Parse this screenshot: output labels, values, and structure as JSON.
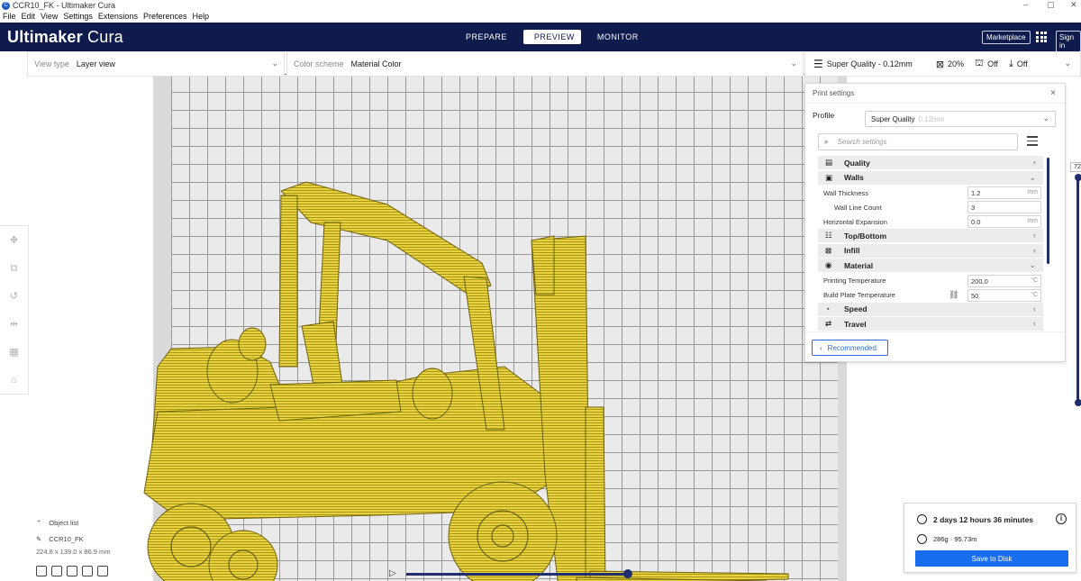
{
  "window": {
    "title": "CCR10_FK - Ultimaker Cura",
    "controls": [
      "–",
      "▢",
      "✕"
    ]
  },
  "menu": [
    "File",
    "Edit",
    "View",
    "Settings",
    "Extensions",
    "Preferences",
    "Help"
  ],
  "header": {
    "brand_bold": "Ultimaker",
    "brand_light": " Cura",
    "stages": [
      "PREPARE",
      "PREVIEW",
      "MONITOR"
    ],
    "active_stage": "PREVIEW",
    "marketplace": "Marketplace",
    "signin": "Sign in"
  },
  "viewtype": {
    "label": "View type",
    "value": "Layer view"
  },
  "colorscheme": {
    "label": "Color scheme",
    "value": "Material Color"
  },
  "quality_bar": {
    "profile": "Super Quality - 0.12mm",
    "infill": "20%",
    "support": "Off",
    "adhesion": "Off"
  },
  "print_settings": {
    "title": "Print settings",
    "profile_label": "Profile",
    "profile_value": "Super Quality",
    "profile_ghost": "0.12mm",
    "search_placeholder": "Search settings",
    "categories": {
      "quality": "Quality",
      "walls": "Walls",
      "topbottom": "Top/Bottom",
      "infill": "Infill",
      "material": "Material",
      "speed": "Speed",
      "travel": "Travel"
    },
    "settings": {
      "wall_thickness": {
        "name": "Wall Thickness",
        "value": "1.2",
        "unit": "mm"
      },
      "wall_line_count": {
        "name": "Wall Line Count",
        "value": "3"
      },
      "horizontal_expansion": {
        "name": "Horizontal Expansion",
        "value": "0.0",
        "unit": "mm"
      },
      "printing_temperature": {
        "name": "Printing Temperature",
        "value": "200.0",
        "unit": "°C"
      },
      "build_plate_temperature": {
        "name": "Build Plate Temperature",
        "value": "50",
        "unit": "°C"
      }
    },
    "recommended": "Recommended"
  },
  "object_list": {
    "title": "Object list",
    "item": "CCR10_FK",
    "dimensions": "224.8 x 139.0 x 86.9 mm"
  },
  "layer_slider": {
    "value": "72"
  },
  "print_info": {
    "time": "2 days 12 hours 36 minutes",
    "material": "286g · 95.73m",
    "save": "Save to Disk"
  },
  "colors": {
    "header_bg": "#0e1b4c",
    "accent": "#196ef0",
    "model_yellow": "#e5cf3c"
  }
}
